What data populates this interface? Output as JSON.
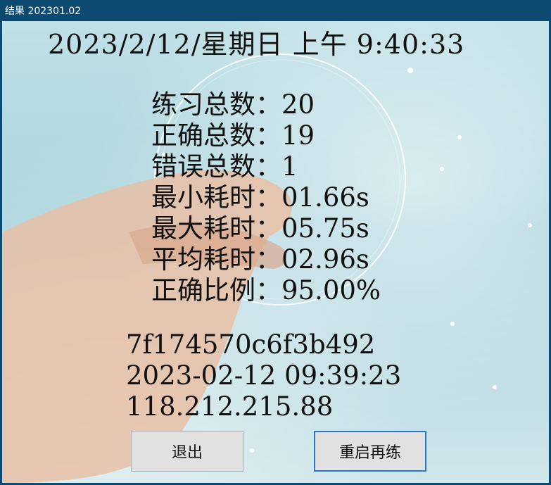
{
  "window": {
    "title": "结果 202301.02"
  },
  "header": {
    "datetime": "2023/2/12/星期日 上午 9:40:33"
  },
  "stats": [
    {
      "label": "练习总数：",
      "value": "20"
    },
    {
      "label": "正确总数：",
      "value": "19"
    },
    {
      "label": "错误总数：",
      "value": "1"
    },
    {
      "label": "最小耗时：",
      "value": "01.66s"
    },
    {
      "label": "最大耗时：",
      "value": "05.75s"
    },
    {
      "label": "平均耗时：",
      "value": "02.96s"
    },
    {
      "label": "正确比例：",
      "value": "95.00%"
    }
  ],
  "info": {
    "code": "7f174570c6f3b492",
    "timestamp": "2023-02-12 09:39:23",
    "ip": "118.212.215.88"
  },
  "buttons": {
    "exit": "退出",
    "restart": "重启再练"
  },
  "colors": {
    "titlebar": "#0c4a72",
    "focus_border": "#2a77c9",
    "button_bg": "#e1e1e1"
  }
}
